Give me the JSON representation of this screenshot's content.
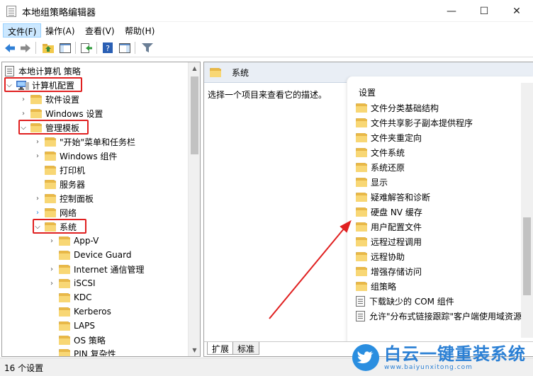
{
  "window": {
    "title": "本地组策略编辑器",
    "minimize": "—",
    "maximize": "☐",
    "close": "✕"
  },
  "menu": {
    "items": [
      "文件(F)",
      "操作(A)",
      "查看(V)",
      "帮助(H)"
    ]
  },
  "toolbar": {
    "icons": [
      "back-arrow-icon",
      "forward-arrow-icon",
      "up-folder-icon",
      "show-hide-tree-icon",
      "export-list-icon",
      "help-icon",
      "action-pane-icon",
      "filter-icon"
    ]
  },
  "tree": {
    "root": "本地计算机 策略",
    "computer_config": "计算机配置",
    "software_settings": "软件设置",
    "windows_settings": "Windows 设置",
    "admin_templates": "管理模板",
    "start_menu": "\"开始\"菜单和任务栏",
    "windows_components": "Windows 组件",
    "printers": "打印机",
    "server": "服务器",
    "control_panel": "控制面板",
    "network": "网络",
    "system": "系统",
    "system_children": [
      "App-V",
      "Device Guard",
      "Internet 通信管理",
      "iSCSI",
      "KDC",
      "Kerberos",
      "LAPS",
      "OS 策略",
      "PIN 复杂性"
    ]
  },
  "right_pane": {
    "header": "系统",
    "description": "选择一个项目来查看它的描述。",
    "settings_header": "设置",
    "folders": [
      "文件分类基础结构",
      "文件共享影子副本提供程序",
      "文件夹重定向",
      "文件系统",
      "系统还原",
      "显示",
      "疑难解答和诊断",
      "硬盘 NV 缓存",
      "用户配置文件",
      "远程过程调用",
      "远程协助",
      "增强存储访问",
      "组策略"
    ],
    "policies": [
      "下载缺少的 COM 组件",
      "允许\"分布式链接跟踪\"客户端使用域资源"
    ],
    "tabs": [
      "扩展",
      "标准"
    ]
  },
  "status": {
    "text": "16 个设置"
  },
  "watermark": {
    "title": "白云一键重装系统",
    "url": "www.baiyunxitong.com"
  },
  "colors": {
    "highlight_box": "#e02020",
    "folder": "#f8d775",
    "accent_blue": "#2a7fd4"
  }
}
